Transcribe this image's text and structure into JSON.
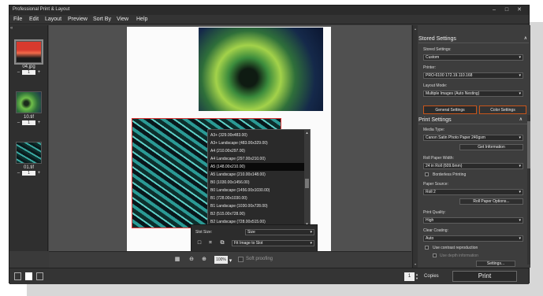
{
  "window": {
    "title": "Professional Print & Layout",
    "controls": [
      "–",
      "□",
      "✕"
    ]
  },
  "menu": [
    "File",
    "Edit",
    "Layout",
    "Preview",
    "Sort By",
    "View",
    "Help"
  ],
  "thumbnails": [
    {
      "name": "04.jpg",
      "copies": "1"
    },
    {
      "name": "10.tif",
      "copies": "1"
    },
    {
      "name": "01.tif",
      "copies": "1"
    }
  ],
  "thumb_panel": {
    "collapse_glyph": "«"
  },
  "settings_panel": {
    "collapse_glyph": "»"
  },
  "media_size_list": {
    "options": [
      "A3+ (329.00x483.00)",
      "A3+ Landscape (483.00x329.00)",
      "A4 (210.00x297.00)",
      "A4 Landscape (297.00x210.00)",
      "A5 (148.00x210.00)",
      "A5 Landscape (210.00x148.00)",
      "B0 (1030.00x1456.00)",
      "B0 Landscape (1456.00x1030.00)",
      "B1 (728.00x1030.00)",
      "B1 Landscape (1030.00x728.00)",
      "B2 (515.00x728.00)",
      "B2 Landscape (728.00x515.00)"
    ],
    "selected_index": 4
  },
  "slot_panel": {
    "label": "Slot Size:",
    "size_value": "Size",
    "fit_value": "Fit Image to Slot",
    "icons": [
      "□",
      "⌗",
      "⧉"
    ]
  },
  "canvas_toolbar": {
    "zoom": "100%",
    "soft_proofing": "Soft proofing",
    "icons": [
      "▦",
      "⊖",
      "⊕",
      "▾"
    ]
  },
  "status": {
    "copies_value": "1",
    "copies_label": "Copies",
    "print_label": "Print",
    "spin": [
      "▲",
      "▼"
    ]
  },
  "stored_settings": {
    "header": "Stored Settings",
    "stored_label": "Stored Settings:",
    "stored_value": "Custom",
    "printer_label": "Printer:",
    "printer_value": "PRO-6100 172.19.110.168",
    "layout_label": "Layout Mode:",
    "layout_value": "Multiple Images (Auto Nesting)"
  },
  "tabs": [
    "General Settings",
    "Color Settings"
  ],
  "print_settings": {
    "header": "Print Settings",
    "media_label": "Media Type:",
    "media_value": "Canon Satin Photo Paper 240gsm",
    "get_info": "Get Information",
    "roll_width_label": "Roll Paper Width:",
    "roll_width_value": "24 in Roll (609.6mm)",
    "borderless": "Borderless Printing",
    "source_label": "Paper Source:",
    "source_value": "Roll 2",
    "roll_options": "Roll Paper Options...",
    "quality_label": "Print Quality:",
    "quality_value": "High",
    "coating_label": "Clear Coating:",
    "coating_value": "Auto",
    "contrast": "Use contrast reproduction",
    "depth": "Use depth information",
    "settings_btn": "Settings..."
  },
  "glyphs": {
    "down": "▾",
    "up": "▴",
    "caret_up": "∧",
    "minus": "–",
    "plus": "+"
  }
}
